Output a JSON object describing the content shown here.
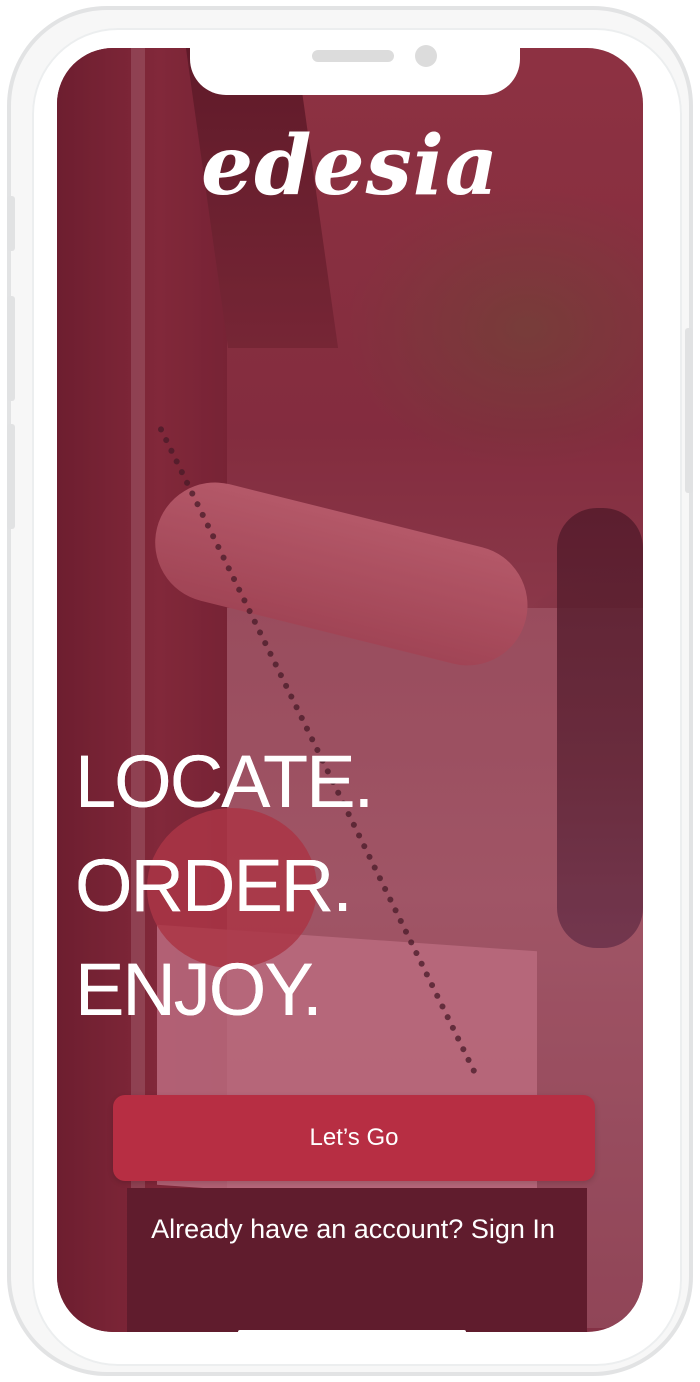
{
  "app": {
    "logo": "edesia"
  },
  "hero": {
    "tagline": [
      "LOCATE.",
      "ORDER.",
      "ENJOY."
    ]
  },
  "actions": {
    "primary_label": "Let’s Go",
    "signin_prompt": "Already have an account?",
    "signin_link": "Sign In"
  },
  "colors": {
    "accent": "#b72e43",
    "overlay": "#961e3c",
    "text": "#ffffff"
  }
}
